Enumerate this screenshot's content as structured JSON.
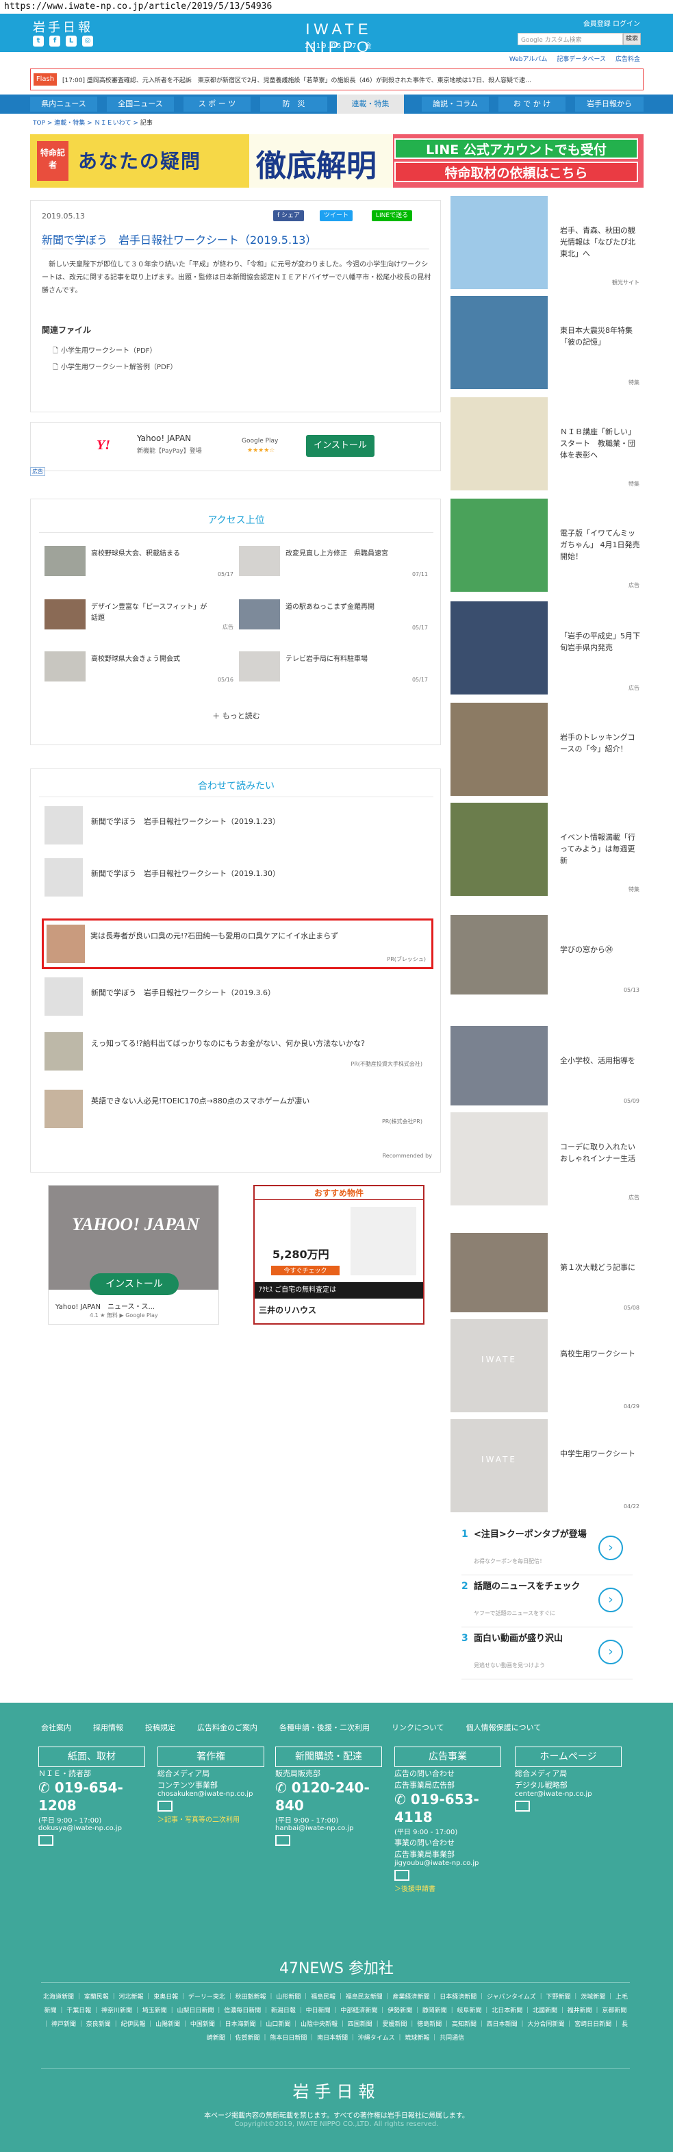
{
  "url": "https://www.iwate-np.co.jp/article/2019/5/13/54936",
  "header": {
    "logo": "岩手日報",
    "brand": "IWATE NIPPO",
    "date": "2019.05.17. 金",
    "links": "会員登録 ログイン",
    "search_placeholder": "Google カスタム検索",
    "search_button": "検索"
  },
  "subnav": [
    "Webアルバム",
    "記事データベース",
    "広告料金"
  ],
  "flash": {
    "tag": "Flash",
    "text": "[17:00] 盛岡高校審査確認、元入所者を不起訴　東京都が新宿区で2月、児童養護施設「若草寮」の施設長（46）が刺殺された事件で、東京地検は17日、殺人容疑で逮…"
  },
  "nav": [
    "県内ニュース",
    "全国ニュース",
    "ス ポ ー ツ",
    "防　災",
    "連載・特集",
    "論説・コラム",
    "お で か け",
    "岩手日報から"
  ],
  "breadcrumb": [
    "TOP",
    "連載・特集",
    "ＮＩＥいわて",
    "記事"
  ],
  "banner": {
    "tag": "特命記者",
    "title": "あなたの疑問",
    "title2": "徹底解明",
    "right1": "LINE 公式アカウントでも受付",
    "right2": "特命取材の依頼はこちら"
  },
  "article": {
    "date": "2019.05.13",
    "share": [
      "f シェア",
      "ツイート",
      "LINEで送る"
    ],
    "title": "新聞で学ぼう　岩手日報社ワークシート（2019.5.13）",
    "body": "新しい天皇陛下が即位して３０年余り続いた「平成」が終わり、「令和」に元号が変わりました。今週の小学生向けワークシートは、改元に関する記事を取り上げます。出題・監修は日本新聞協会認定ＮＩＥアドバイザーで八幡平市・松尾小校長の昆村勝さんです。",
    "files_title": "関連ファイル",
    "files": [
      "小学生用ワークシート（PDF）",
      "小学生用ワークシート解答例（PDF）"
    ]
  },
  "appad": {
    "logo": "Y!",
    "name": "Yahoo! JAPAN",
    "sub": "新機能【PayPay】登場",
    "store": "Google Play",
    "stars": "★★★★☆",
    "button": "インストール",
    "ad_label": "広告"
  },
  "ranking": {
    "title": "アクセス上位",
    "items": [
      {
        "text": "高校野球県大会、釈載結まる",
        "date": "05/17"
      },
      {
        "text": "改変見直し上方修正　県職員速宮",
        "date": "07/11"
      },
      {
        "text": "デザイン豊富な「ピースフィット」が話題",
        "date": "広告"
      },
      {
        "text": "道の駅あねっこまず金羅再開",
        "date": "05/17"
      },
      {
        "text": "高校野球県大会きょう開会式",
        "date": "05/16"
      },
      {
        "text": "テレビ岩手局に有料駐車場",
        "date": "05/17"
      }
    ],
    "more": "もっと読む"
  },
  "recommend": {
    "title": "合わせて読みたい",
    "items": [
      {
        "text": "新聞で学ぼう　岩手日報社ワークシート（2019.1.23）",
        "pr": ""
      },
      {
        "text": "新聞で学ぼう　岩手日報社ワークシート（2019.1.30）",
        "pr": ""
      },
      {
        "text": "実は長寿者が良い口臭の元!?石田純一も愛用の口臭ケアにイイ水止まらず",
        "pr": "PR(ブレッシュ)"
      },
      {
        "text": "新聞で学ぼう　岩手日報社ワークシート（2019.3.6）",
        "pr": ""
      },
      {
        "text": "えっ知ってる!?給料出てばっかりなのにもうお金がない、何か良い方法ないかな?",
        "pr": "PR(不動産投資大手株式会社)"
      },
      {
        "text": "英語できない人必見!TOEIC170点→880点のスマホゲームが凄い",
        "pr": "PR(株式会社PR)"
      }
    ],
    "credit": "Recommended by"
  },
  "ad_yahoo": {
    "brand": "YAHOO! JAPAN",
    "button": "インストール",
    "text": "Yahoo! JAPAN　ニュース・ス...",
    "sub": "4.1 ★ 無料 ▶ Google Play"
  },
  "ad_mitsui": {
    "head": "おすすめ物件",
    "price": "5,280万円",
    "check": "今すぐチェック",
    "bar": "ｱｸｾｽ ご自宅の無料査定は",
    "brand": "三井のリハウス"
  },
  "sidebar": [
    {
      "text": "岩手、青森、秋田の観光情報は「なびたび北東北」へ",
      "src": "観光サイト"
    },
    {
      "text": "東日本大震災8年特集「彼の記憶」",
      "src": "特集"
    },
    {
      "text": "ＮＩＢ講座「新しい」スタート　教職業・団体を表彰へ",
      "src": "特集"
    },
    {
      "text": "電子版「イワてんミッガちゃん」 4月1日発売開始！",
      "src": "広告"
    },
    {
      "text": "「岩手の平成史」5月下旬岩手県内発売",
      "src": "広告"
    },
    {
      "text": "岩手のトレッキングコースの「今」紹介！",
      "src": ""
    },
    {
      "text": "イベント情報満載「行ってみよう」は毎週更新",
      "src": "特集"
    },
    {
      "text": "学びの窓から㉔",
      "src": "05/13"
    },
    {
      "text": "全小学校、活用指導を",
      "src": "05/09"
    },
    {
      "text": "コーデに取り入れたいおしゃれインナー生活",
      "src": "広告"
    },
    {
      "text": "第１次大戦どう記事に",
      "src": "05/08"
    },
    {
      "text": "高校生用ワークシート",
      "src": "04/29"
    },
    {
      "text": "中学生用ワークシート",
      "src": "04/22"
    }
  ],
  "pr_list": [
    {
      "n": "1",
      "t": "<注目>クーポンタブが登場",
      "s": "お得なクーポンを毎日配信！"
    },
    {
      "n": "2",
      "t": "話題のニュースをチェック",
      "s": "ヤフーで話題のニュースをすぐに"
    },
    {
      "n": "3",
      "t": "面白い動画が盛り沢山",
      "s": "見逃せない動画を見つけよう"
    }
  ],
  "footer": {
    "links": [
      "会社案内",
      "採用情報",
      "投稿規定",
      "広告料金のご案内",
      "各種申請・後援・二次利用",
      "リンクについて",
      "個人情報保護について"
    ],
    "cols": [
      {
        "hd": "紙面、取材",
        "l1": "ＮＩＥ・読者部",
        "ph": "019-654-1208",
        "hours": "(平日 9:00 - 17:00)",
        "mail": "dokusya@iwate-np.co.jp",
        "extra": ""
      },
      {
        "hd": "著作権",
        "l1": "総合メディア局",
        "l2": "コンテンツ事業部",
        "mail": "chosakuken@iwate-np.co.jp",
        "extra": "＞記事・写真等の二次利用"
      },
      {
        "hd": "新聞購読・配達",
        "l1": "販売局販売部",
        "ph": "0120-240-840",
        "hours": "(平日 9:00 - 17:00)",
        "mail": "hanbai@iwate-np.co.jp",
        "extra": ""
      },
      {
        "hd": "広告事業",
        "l1": "広告の問い合わせ",
        "l2": "広告事業局広告部",
        "ph": "019-653-4118",
        "hours": "(平日 9:00 - 17:00)",
        "l3": "事業の問い合わせ",
        "l4": "広告事業局事業部",
        "mail": "jigyoubu@iwate-np.co.jp",
        "extra": "＞後援申請書"
      },
      {
        "hd": "ホームページ",
        "l1": "総合メディア局",
        "l2": "デジタル戦略部",
        "mail": "center@iwate-np.co.jp",
        "extra": ""
      }
    ],
    "news47": "47NEWS 参加社",
    "papers": "北海道新聞 ｜ 室蘭民報 ｜ 河北新報 ｜ 東奥日報 ｜ デーリー東北 ｜ 秋田魁新報 ｜ 山形新聞 ｜ 福島民報 ｜ 福島民友新聞 ｜ 産業経済新聞 ｜ 日本経済新聞 ｜ ジャパンタイムズ ｜ 下野新聞 ｜ 茨城新聞 ｜ 上毛新聞 ｜ 千葉日報 ｜ 神奈川新聞 ｜ 埼玉新聞 ｜ 山梨日日新聞 ｜ 信濃毎日新聞 ｜ 新潟日報 ｜ 中日新聞 ｜ 中部経済新聞 ｜ 伊勢新聞 ｜ 静岡新聞 ｜ 岐阜新聞 ｜ 北日本新聞 ｜ 北國新聞 ｜ 福井新聞 ｜ 京都新聞 ｜ 神戸新聞 ｜ 奈良新聞 ｜ 紀伊民報 ｜ 山陽新聞 ｜ 中国新聞 ｜ 日本海新聞 ｜ 山口新聞 ｜ 山陰中央新報 ｜ 四国新聞 ｜ 愛媛新聞 ｜ 徳島新聞 ｜ 高知新聞 ｜ 西日本新聞 ｜ 大分合同新聞 ｜ 宮崎日日新聞 ｜ 長崎新聞 ｜ 佐賀新聞 ｜ 熊本日日新聞 ｜ 南日本新聞 ｜ 沖縄タイムス ｜ 琉球新報 ｜ 共同通信",
    "logo": "岩手日報",
    "copy1": "本ページ掲載内容の無断転載を禁じます。すべての著作権は岩手日報社に帰属します。",
    "copy2": "Copyright©2019, IWATE NIPPO CO.,LTD. All rights reserved."
  }
}
